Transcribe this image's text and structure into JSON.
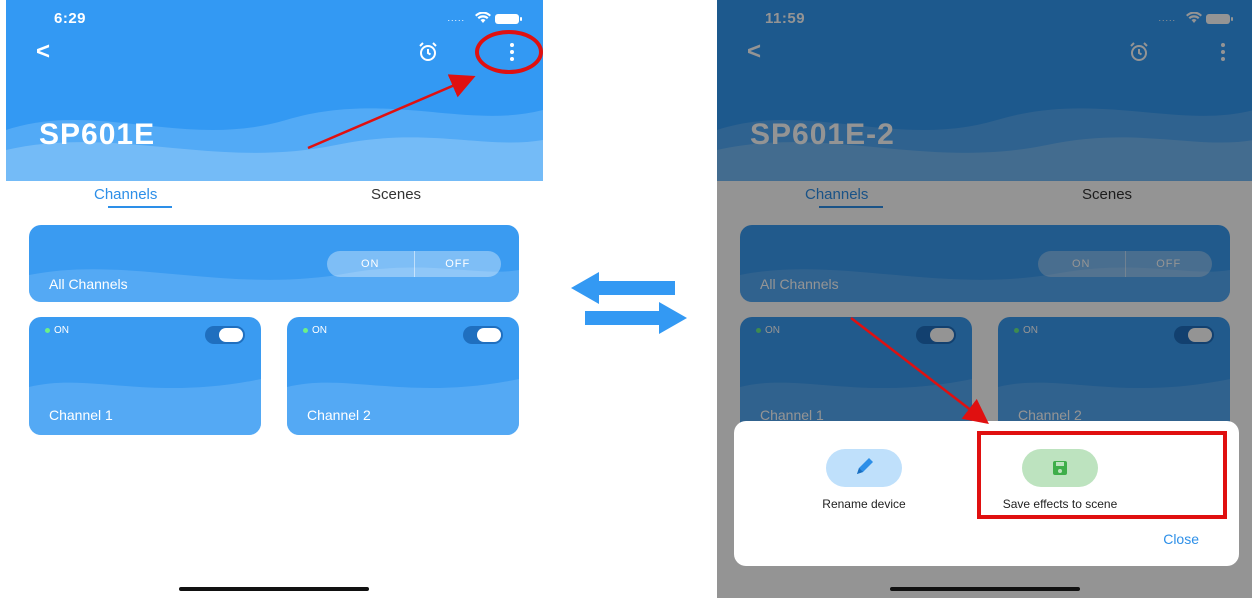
{
  "left_screen": {
    "status_bar": {
      "time": "6:29",
      "signal": ".....",
      "wifi": "wifi-icon",
      "battery": "battery-icon"
    },
    "header": {
      "back_icon": "<",
      "alarm_icon": "alarm-clock-icon",
      "more_icon": "more-vertical-icon",
      "device_name": "SP601E"
    },
    "tabs": {
      "channels": "Channels",
      "scenes": "Scenes",
      "active": "Channels"
    },
    "all_channels": {
      "label": "All Channels",
      "on": "ON",
      "off": "OFF"
    },
    "channels": [
      {
        "label": "Channel 1",
        "status": "ON",
        "toggle_on": true
      },
      {
        "label": "Channel 2",
        "status": "ON",
        "toggle_on": true
      }
    ]
  },
  "right_screen": {
    "status_bar": {
      "time": "11:59",
      "signal": ".....",
      "wifi": "wifi-icon",
      "battery": "battery-icon"
    },
    "header": {
      "back_icon": "<",
      "alarm_icon": "alarm-clock-icon",
      "more_icon": "more-vertical-icon",
      "device_name": "SP601E-2"
    },
    "tabs": {
      "channels": "Channels",
      "scenes": "Scenes",
      "active": "Channels"
    },
    "all_channels": {
      "label": "All Channels",
      "on": "ON",
      "off": "OFF"
    },
    "channels": [
      {
        "label": "Channel 1",
        "status": "ON",
        "toggle_on": true
      },
      {
        "label": "Channel 2",
        "status": "ON",
        "toggle_on": true
      }
    ],
    "action_sheet": {
      "rename": {
        "label": "Rename device",
        "icon": "pencil-icon"
      },
      "save": {
        "label": "Save effects to scene",
        "icon": "save-icon"
      },
      "close": "Close"
    }
  },
  "colors": {
    "header_blue": "#3399f3",
    "accent": "#2d8fe8",
    "annotation_red": "#e01010",
    "rename_icon_bg": "#bfe0fb",
    "save_icon_bg": "#bde3bf"
  },
  "annotations": {
    "swap_icon": "swap-arrows-icon",
    "left_highlight": "more-button-circle",
    "right_highlight": "save-effects-box"
  }
}
